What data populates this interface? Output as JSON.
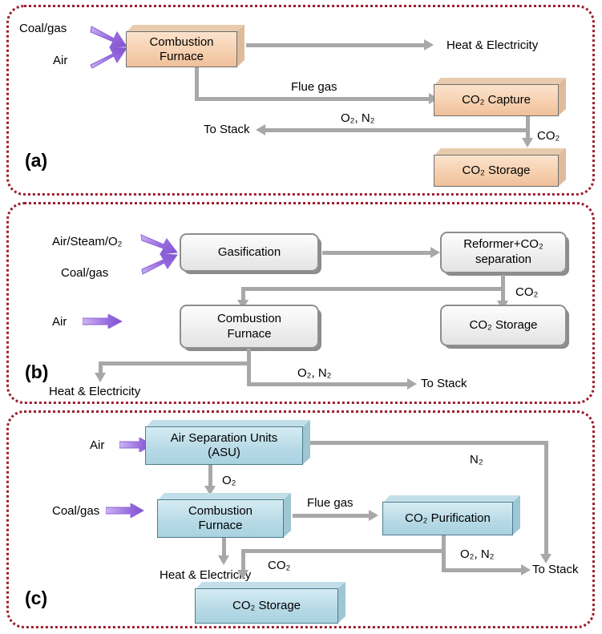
{
  "figure": {
    "type": "process-flow-diagram",
    "description": "Three carbon capture configurations: post-combustion, pre-combustion and oxy-fuel combustion",
    "accent_border_color": "#9c1f2e",
    "arrow_color": "#a8a8a8",
    "feed_arrow_color": "#9b6fe0"
  },
  "panels": [
    {
      "id": "a",
      "label": "(a)",
      "box_fill": "#f6d0b0",
      "boxes": [
        {
          "name": "combustion-furnace",
          "lines": [
            "Combustion",
            "Furnace"
          ]
        },
        {
          "name": "co2-capture",
          "lines": [
            "CO₂ Capture"
          ]
        },
        {
          "name": "co2-storage",
          "lines": [
            "CO₂ Storage"
          ]
        }
      ],
      "inputs": [
        {
          "name": "coal-gas",
          "label": "Coal/gas"
        },
        {
          "name": "air",
          "label": "Air"
        }
      ],
      "stream_labels": [
        {
          "name": "heat-electricity",
          "label": "Heat & Electricity"
        },
        {
          "name": "flue-gas",
          "label": "Flue gas"
        },
        {
          "name": "o2-n2",
          "label": "O₂, N₂"
        },
        {
          "name": "to-stack",
          "label": "To Stack"
        },
        {
          "name": "co2",
          "label": "CO₂"
        }
      ]
    },
    {
      "id": "b",
      "label": "(b)",
      "box_fill": "#efefef",
      "boxes": [
        {
          "name": "gasification",
          "lines": [
            "Gasification"
          ]
        },
        {
          "name": "reformer-co2-separation",
          "lines": [
            "Reformer+CO₂",
            "separation"
          ]
        },
        {
          "name": "combustion-furnace",
          "lines": [
            "Combustion",
            "Furnace"
          ]
        },
        {
          "name": "co2-storage",
          "lines": [
            "CO₂ Storage"
          ]
        }
      ],
      "inputs": [
        {
          "name": "air-steam-o2",
          "label": "Air/Steam/O₂"
        },
        {
          "name": "coal-gas",
          "label": "Coal/gas"
        },
        {
          "name": "air",
          "label": "Air"
        }
      ],
      "stream_labels": [
        {
          "name": "co2",
          "label": "CO₂"
        },
        {
          "name": "heat-electricity",
          "label": "Heat & Electricity"
        },
        {
          "name": "o2-n2",
          "label": "O₂, N₂"
        },
        {
          "name": "to-stack",
          "label": "To Stack"
        }
      ]
    },
    {
      "id": "c",
      "label": "(c)",
      "box_fill": "#b6d9e6",
      "boxes": [
        {
          "name": "air-separation-units",
          "lines": [
            "Air Separation Units",
            "(ASU)"
          ]
        },
        {
          "name": "combustion-furnace",
          "lines": [
            "Combustion",
            "Furnace"
          ]
        },
        {
          "name": "co2-purification",
          "lines": [
            "CO₂ Purification"
          ]
        },
        {
          "name": "co2-storage",
          "lines": [
            "CO₂ Storage"
          ]
        }
      ],
      "inputs": [
        {
          "name": "air",
          "label": "Air"
        },
        {
          "name": "coal-gas",
          "label": "Coal/gas"
        }
      ],
      "stream_labels": [
        {
          "name": "n2",
          "label": "N₂"
        },
        {
          "name": "o2",
          "label": "O₂"
        },
        {
          "name": "flue-gas",
          "label": "Flue gas"
        },
        {
          "name": "heat-electricity",
          "label": "Heat & Electricity"
        },
        {
          "name": "co2",
          "label": "CO₂"
        },
        {
          "name": "o2-n2",
          "label": "O₂, N₂"
        },
        {
          "name": "to-stack",
          "label": "To Stack"
        }
      ]
    }
  ]
}
